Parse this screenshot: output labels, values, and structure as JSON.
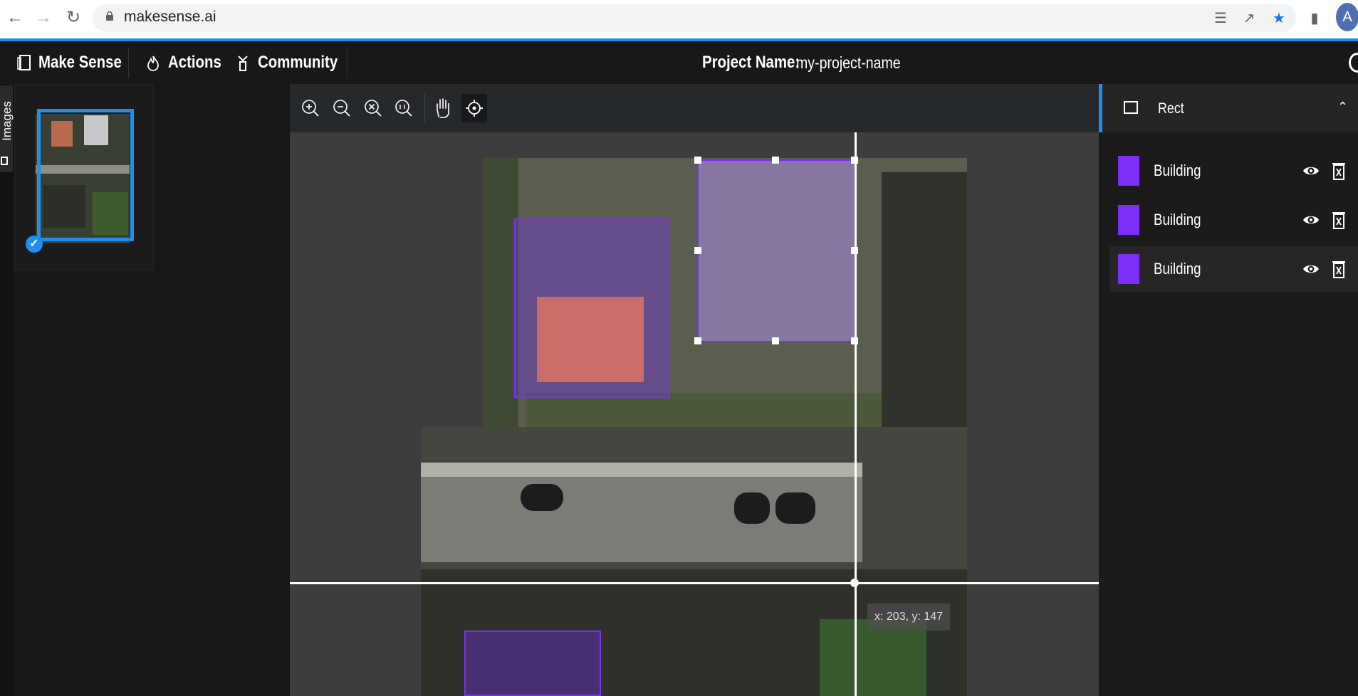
{
  "browser": {
    "url": "makesense.ai",
    "avatar_letter": "A",
    "icons": [
      "back-icon",
      "forward-icon",
      "reload-icon",
      "lock-icon",
      "translate-icon",
      "share-icon",
      "star-icon",
      "sidepanel-icon"
    ]
  },
  "app": {
    "brand": "Make Sense",
    "nav_actions": "Actions",
    "nav_community": "Community",
    "project_label": "Project Name:",
    "project_name": "my-project-name"
  },
  "sidebar": {
    "images_tab_label": "Images"
  },
  "toolbar": {
    "tools": [
      "zoom-in",
      "zoom-out",
      "zoom-fit",
      "zoom-actual",
      "pan",
      "crosshair"
    ],
    "active_tool": "crosshair"
  },
  "canvas": {
    "cursor_readout": "x: 203, y: 147"
  },
  "right_panel": {
    "section_title": "Rect",
    "labels": [
      {
        "name": "Building",
        "color": "#7b2ff7"
      },
      {
        "name": "Building",
        "color": "#7b2ff7"
      },
      {
        "name": "Building",
        "color": "#7b2ff7"
      }
    ]
  },
  "colors": {
    "accent": "#1f8ef1",
    "label_purple": "#7b2ff7"
  }
}
